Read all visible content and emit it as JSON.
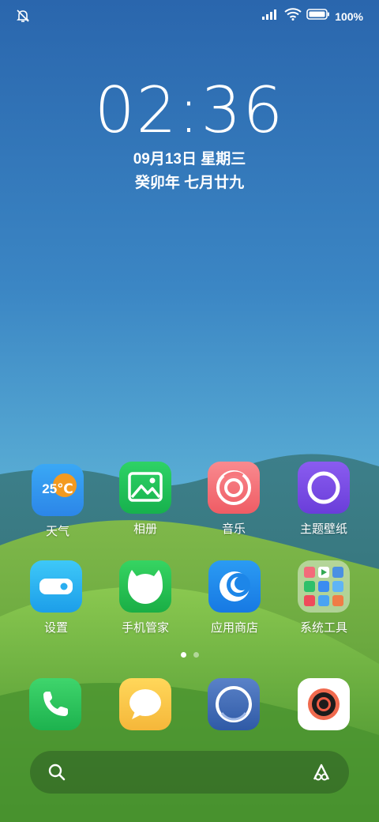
{
  "status_bar": {
    "left_icon": "bell-off-icon",
    "signal_icon": "signal-icon",
    "wifi_icon": "wifi-icon",
    "battery_icon": "battery-icon",
    "battery_percent": "100%"
  },
  "lock": {
    "time": "02:36",
    "date": "09月13日 星期三",
    "lunar": "癸卯年 七月廿九"
  },
  "apps": [
    {
      "label": "天气",
      "icon": "weather-icon",
      "temp": "25℃"
    },
    {
      "label": "相册",
      "icon": "gallery-icon"
    },
    {
      "label": "音乐",
      "icon": "music-icon"
    },
    {
      "label": "主题壁纸",
      "icon": "theme-icon"
    },
    {
      "label": "设置",
      "icon": "settings-icon"
    },
    {
      "label": "手机管家",
      "icon": "phone-manager-icon"
    },
    {
      "label": "应用商店",
      "icon": "app-store-icon"
    },
    {
      "label": "系统工具",
      "icon": "system-tools-folder-icon"
    }
  ],
  "dock": [
    {
      "icon": "phone-icon"
    },
    {
      "icon": "messages-icon"
    },
    {
      "icon": "browser-icon"
    },
    {
      "icon": "camera-icon"
    }
  ],
  "page_indicator": {
    "pages": 2,
    "current": 1
  },
  "search_bar": {
    "left_icon": "search-icon",
    "right_icon": "assistant-icon"
  },
  "colors": {
    "sky_top": "#2c6fb6",
    "sky_bottom": "#5aaed6",
    "grass": "#6ab335"
  }
}
